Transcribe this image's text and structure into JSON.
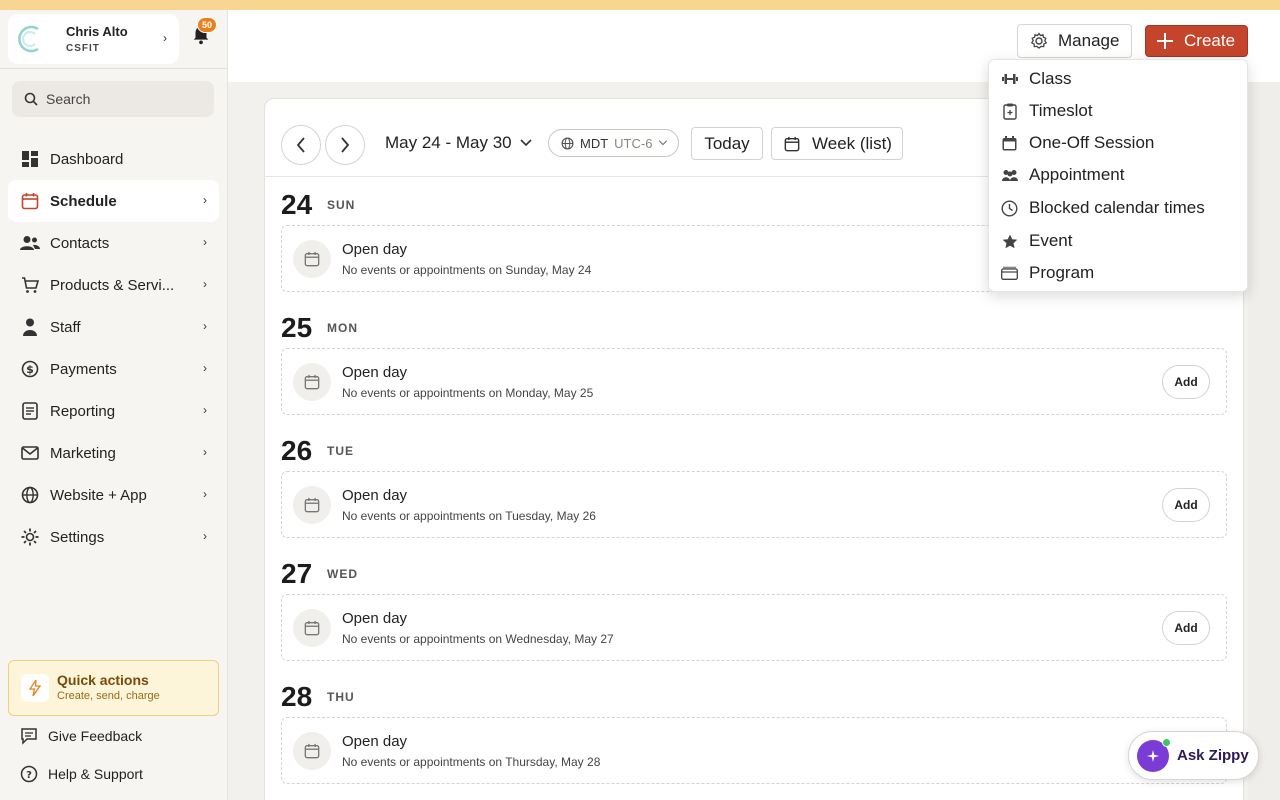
{
  "user": {
    "name": "Chris Alto",
    "org": "CSFIT"
  },
  "notifications": {
    "count": "50"
  },
  "search": {
    "placeholder": "Search"
  },
  "sidebar": {
    "items": [
      {
        "label": "Dashboard",
        "icon": "dashboard-icon",
        "active": false,
        "chevron": false
      },
      {
        "label": "Schedule",
        "icon": "calendar-icon",
        "active": true,
        "chevron": true
      },
      {
        "label": "Contacts",
        "icon": "contacts-icon",
        "active": false,
        "chevron": true
      },
      {
        "label": "Products & Servi...",
        "icon": "cart-icon",
        "active": false,
        "chevron": true
      },
      {
        "label": "Staff",
        "icon": "person-icon",
        "active": false,
        "chevron": true
      },
      {
        "label": "Payments",
        "icon": "dollar-icon",
        "active": false,
        "chevron": true
      },
      {
        "label": "Reporting",
        "icon": "report-icon",
        "active": false,
        "chevron": true
      },
      {
        "label": "Marketing",
        "icon": "mail-icon",
        "active": false,
        "chevron": true
      },
      {
        "label": "Website + App",
        "icon": "globe-icon",
        "active": false,
        "chevron": true
      },
      {
        "label": "Settings",
        "icon": "gear-icon",
        "active": false,
        "chevron": true
      }
    ]
  },
  "quick_actions": {
    "title": "Quick actions",
    "subtitle": "Create, send, charge"
  },
  "footer": {
    "feedback": "Give Feedback",
    "help": "Help & Support"
  },
  "header": {
    "manage_label": "Manage",
    "create_label": "Create"
  },
  "create_menu": {
    "items": [
      {
        "label": "Class",
        "icon": "dumbbell-icon"
      },
      {
        "label": "Timeslot",
        "icon": "clipboard-icon"
      },
      {
        "label": "One-Off Session",
        "icon": "calendar-filled-icon"
      },
      {
        "label": "Appointment",
        "icon": "people-icon"
      },
      {
        "label": "Blocked calendar times",
        "icon": "clock-icon"
      },
      {
        "label": "Event",
        "icon": "star-icon"
      },
      {
        "label": "Program",
        "icon": "folder-icon"
      }
    ]
  },
  "toolbar": {
    "date_range": "May 24 - May 30",
    "timezone": "MDT",
    "utc_offset": "UTC-6",
    "today_label": "Today",
    "view_label": "Week (list)"
  },
  "days": [
    {
      "num": "24",
      "name": "SUN",
      "title": "Open day",
      "desc": "No events or appointments on Sunday, May 24",
      "add": ""
    },
    {
      "num": "25",
      "name": "MON",
      "title": "Open day",
      "desc": "No events or appointments on Monday, May 25",
      "add": "Add"
    },
    {
      "num": "26",
      "name": "TUE",
      "title": "Open day",
      "desc": "No events or appointments on Tuesday, May 26",
      "add": "Add"
    },
    {
      "num": "27",
      "name": "WED",
      "title": "Open day",
      "desc": "No events or appointments on Wednesday, May 27",
      "add": "Add"
    },
    {
      "num": "28",
      "name": "THU",
      "title": "Open day",
      "desc": "No events or appointments on Thursday, May 28",
      "add": ""
    }
  ],
  "assistant": {
    "label": "Ask Zippy"
  },
  "colors": {
    "accent": "#c4452b",
    "banner": "#f9d592",
    "assistant": "#7b3bd6",
    "badge": "#e8801c"
  }
}
